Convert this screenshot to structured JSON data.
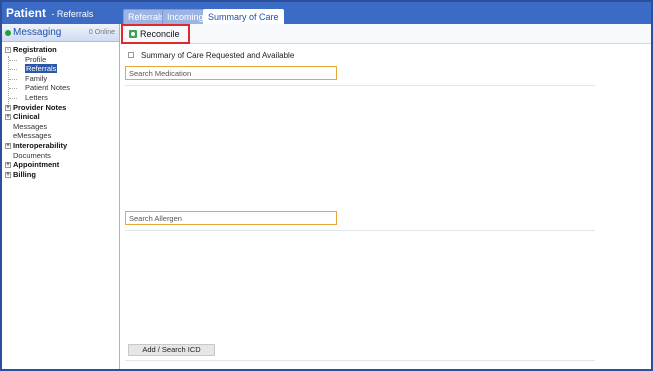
{
  "header": {
    "title": "Patient",
    "subtitle": "- Referrals",
    "color": "#3b6bc4"
  },
  "tabs": [
    {
      "label": "Referrals",
      "active": false
    },
    {
      "label": "Incoming",
      "active": false
    },
    {
      "label": "Summary of Care",
      "active": true
    }
  ],
  "sidebar": {
    "title": "Messaging",
    "status": "0 Online",
    "status_color": "#1fa33a",
    "tree": {
      "registration": "Registration",
      "profile": "Profile",
      "referrals": "Referrals",
      "family": "Family",
      "patient_notes": "Patient Notes",
      "letters": "Letters",
      "provider_notes": "Provider Notes",
      "clinical": "Clinical",
      "messages": "Messages",
      "emessages": "eMessages",
      "interoperability": "Interoperability",
      "documents": "Documents",
      "appointment": "Appointment",
      "billing": "Billing"
    },
    "expander_collapsed": "+",
    "expander_expanded": "-"
  },
  "toolbar": {
    "reconcile_label": "Reconcile",
    "highlight_color": "#e02a2a"
  },
  "main": {
    "checkbox_label": "Summary of Care Requested and Available",
    "checkbox_checked": false,
    "search_medication_placeholder": "Search Medication",
    "search_allergen_placeholder": "Search Allergen",
    "add_icd_label": "Add / Search ICD"
  }
}
